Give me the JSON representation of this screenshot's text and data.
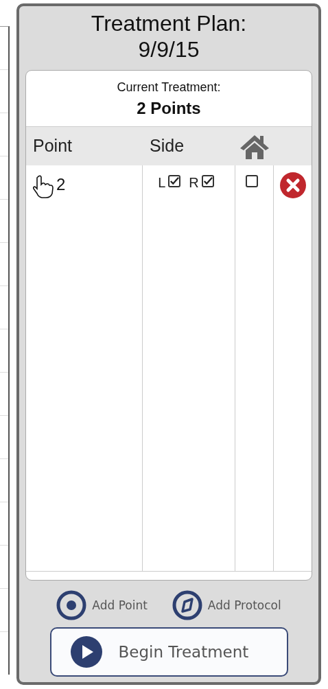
{
  "panel": {
    "title": "Treatment Plan:",
    "date": "9/9/15"
  },
  "current_treatment": {
    "label": "Current Treatment:",
    "value": "2 Points"
  },
  "table": {
    "columns": [
      "Point",
      "Side"
    ],
    "rows": [
      {
        "point": "2",
        "left": {
          "label": "L",
          "checked": true
        },
        "right": {
          "label": "R",
          "checked": true
        },
        "home": false
      }
    ]
  },
  "actions": [
    {
      "kind": "point",
      "label": "Add Point"
    },
    {
      "kind": "protocol",
      "label": "Add Protocol"
    }
  ],
  "begin_button": "Begin Treatment"
}
